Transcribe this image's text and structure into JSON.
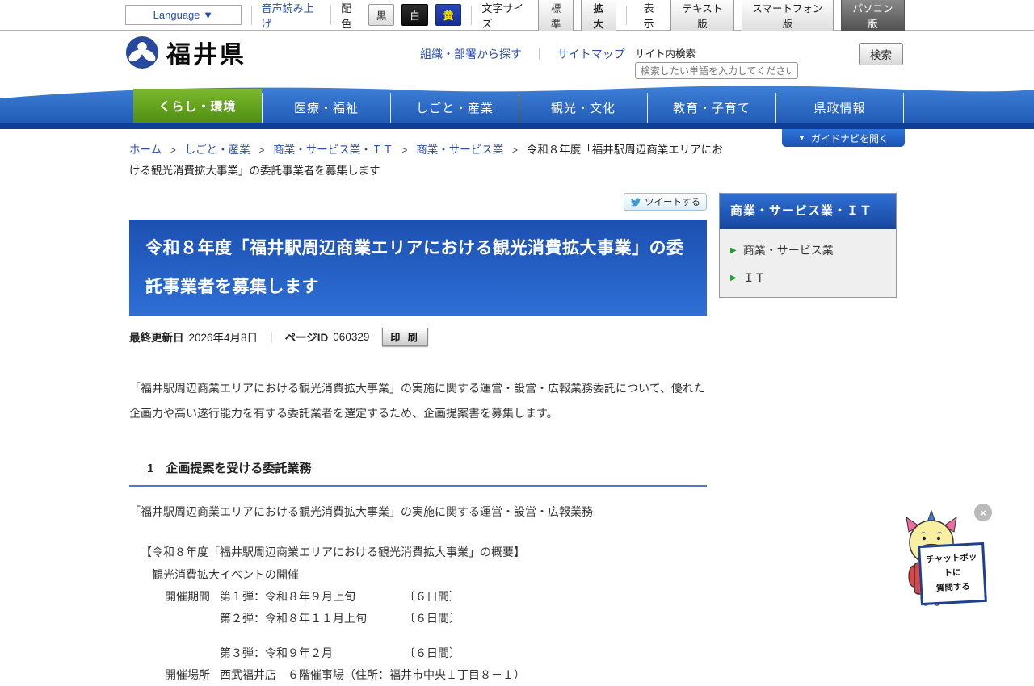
{
  "colors": {
    "nav_blue": "#2a68c8",
    "nav_dark_strip": "#0f3e96",
    "tab_green": "#5fa01c",
    "title_blue": "#2362c8",
    "link_blue": "#2a50a8",
    "accent_yellow_btn_text": "#ffe800"
  },
  "top_bar": {
    "language_label": "Language ▼",
    "audio_label": "音声読み上げ",
    "color_label": "配色",
    "color_black": "黒",
    "color_white": "白",
    "color_yellow": "黄",
    "fontsize_label": "文字サイズ",
    "fontsize_standard": "標準",
    "fontsize_large": "拡大",
    "view_label": "表示",
    "view_text": "テキスト版",
    "view_smartphone": "スマートフォン版",
    "view_pc": "パソコン版"
  },
  "header": {
    "site_name": "福井県",
    "link_org": "組織・部署から探す",
    "link_separator": "｜",
    "link_sitemap": "サイトマップ",
    "search_label": "サイト内検索",
    "search_placeholder": "検索したい単語を入力してください",
    "search_button": "検索"
  },
  "nav": {
    "items": [
      {
        "label": "くらし・環境"
      },
      {
        "label": "医療・福祉"
      },
      {
        "label": "しごと・産業"
      },
      {
        "label": "観光・文化"
      },
      {
        "label": "教育・子育て"
      },
      {
        "label": "県政情報"
      }
    ],
    "guide_button_icon": "▼",
    "guide_button": "ガイドナビを開く"
  },
  "breadcrumb": {
    "links": [
      "ホーム",
      "しごと・産業",
      "商業・サービス業・ＩＴ",
      "商業・サービス業"
    ],
    "separator": ">",
    "current": "令和８年度「福井駅周辺商業エリアにおける観光消費拡大事業」の委託事業者を募集します"
  },
  "tweet_button": "ツイートする",
  "article": {
    "title": "令和８年度「福井駅周辺商業エリアにおける観光消費拡大事業」の委託事業者を募集します",
    "meta": {
      "updated_label": "最終更新日",
      "updated_date": "2026年4月8日",
      "separator": "｜",
      "page_id_label": "ページID",
      "page_id": "060329",
      "print_label": "印 刷"
    },
    "intro": "「福井駅周辺商業エリアにおける観光消費拡大事業」の実施に関する運営・設営・広報業務委託について、優れた企画力や高い遂行能力を有する委託業者を選定するため、企画提案書を募集します。",
    "section1": {
      "heading": "1　企画提案を受ける委託業務",
      "body": "「福井駅周辺商業エリアにおける観光消費拡大事業」の実施に関する運営・設営・広報業務",
      "overview_title": "【令和８年度「福井駅周辺商業エリアにおける観光消費拡大事業」の概要】",
      "event_line": "観光消費拡大イベントの開催",
      "period_label": "開催期間",
      "period1": "第１弾：令和８年９月上旬",
      "period1_days": "〔６日間〕",
      "period2": "第２弾：令和８年１１月上旬",
      "period2_days": "〔６日間〕",
      "period3": "第３弾：令和９年２月",
      "period3_days": "〔６日間〕",
      "place_label": "開催場所",
      "place": "西武福井店　６階催事場（住所：福井市中央１丁目８－１）"
    }
  },
  "sidebar": {
    "title": "商業・サービス業・ＩＴ",
    "items": [
      {
        "label": "商業・サービス業"
      },
      {
        "label": "ＩＴ"
      }
    ]
  },
  "chatbot": {
    "close_label": "×",
    "sign_line1": "チャットボットに",
    "sign_line2": "質問する"
  }
}
